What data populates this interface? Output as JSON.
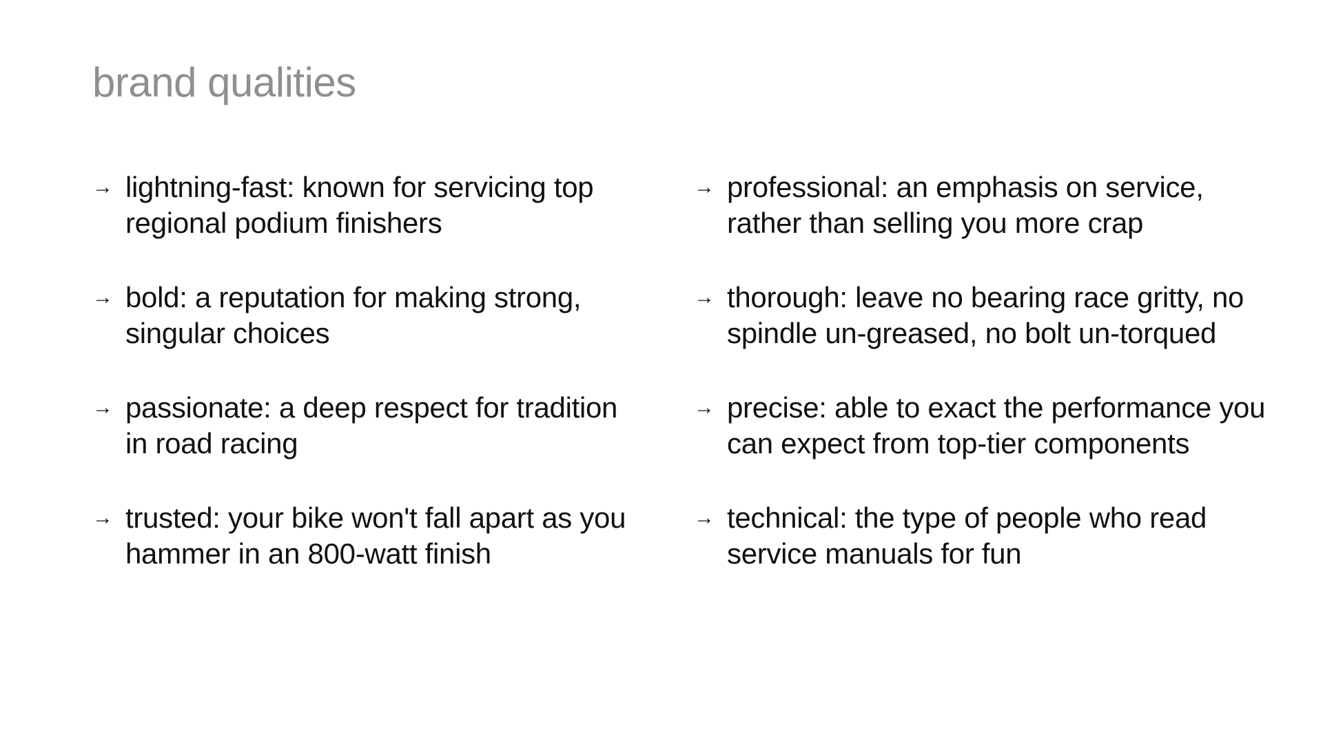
{
  "slide": {
    "title": "brand qualities",
    "arrow_glyph": "→",
    "left_items": [
      {
        "text": "lightning-fast: known for servicing top regional podium finishers"
      },
      {
        "text": "bold: a reputation for making strong, singular choices"
      },
      {
        "text": "passionate: a deep respect for tradition in road racing"
      },
      {
        "text": "trusted: your bike won't fall apart as you hammer in an 800-watt finish"
      }
    ],
    "right_items": [
      {
        "text": "professional: an emphasis on service, rather than selling you more crap"
      },
      {
        "text": "thorough: leave no bearing race gritty, no spindle un-greased, no bolt un-torqued"
      },
      {
        "text": "precise: able to exact the performance you can expect from top-tier components"
      },
      {
        "text": "technical: the type of people who read service manuals for fun"
      }
    ],
    "colors": {
      "title": "#8f8f8f",
      "text": "#111111",
      "background": "#ffffff"
    }
  }
}
